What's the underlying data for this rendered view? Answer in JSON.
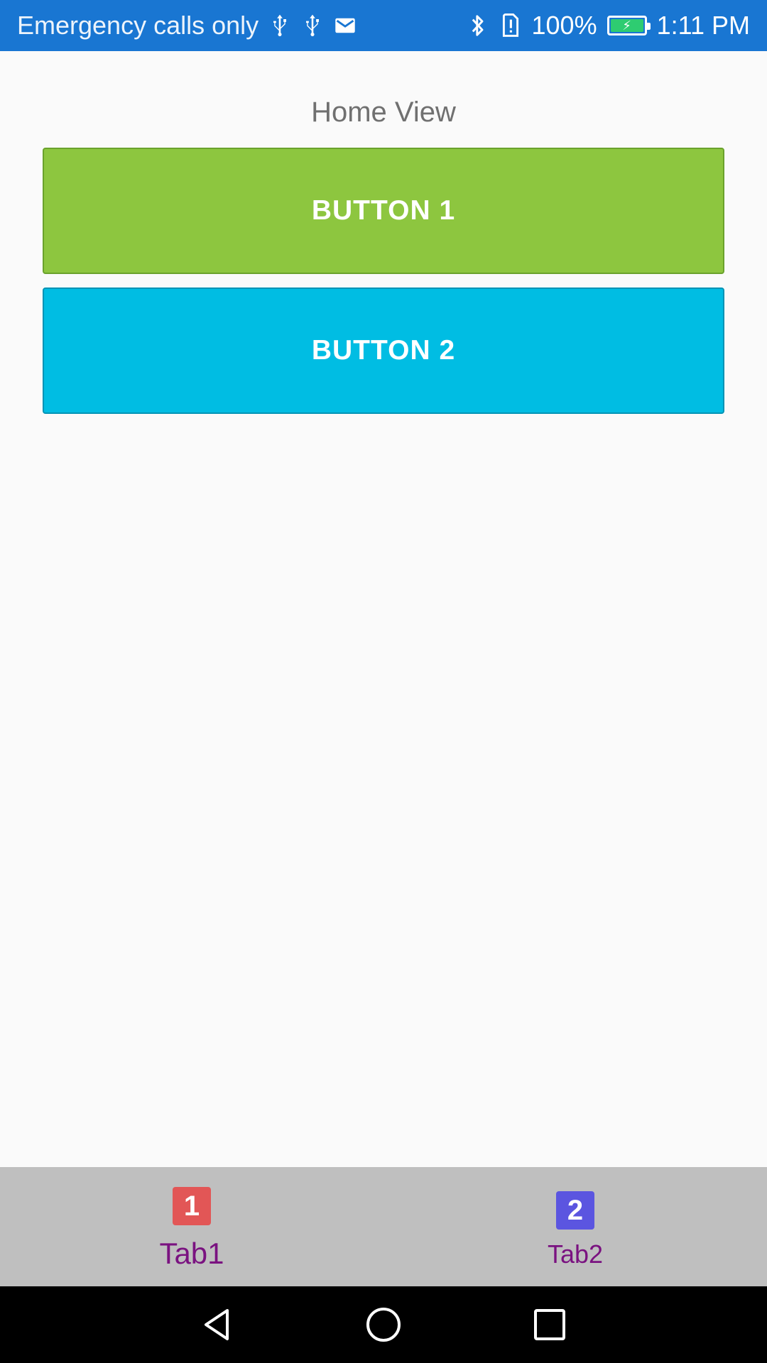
{
  "status_bar": {
    "carrier": "Emergency calls only",
    "battery_percent": "100%",
    "time": "1:11 PM",
    "icons": [
      "usb-icon",
      "usb-icon",
      "mail-icon",
      "bluetooth-icon",
      "sim-alert-icon",
      "battery-charging-icon"
    ],
    "background": "#1976d2"
  },
  "main": {
    "title": "Home View",
    "buttons": [
      {
        "label": "BUTTON 1",
        "color": "#8dc63f"
      },
      {
        "label": "BUTTON 2",
        "color": "#00bde3"
      }
    ]
  },
  "tabs": [
    {
      "label": "Tab1",
      "icon_text": "1",
      "icon_color": "#e25656",
      "selected": true
    },
    {
      "label": "Tab2",
      "icon_text": "2",
      "icon_color": "#5b55e0",
      "selected": false
    }
  ],
  "nav_bar": {
    "icons": [
      "back-icon",
      "home-icon",
      "recents-icon"
    ]
  }
}
